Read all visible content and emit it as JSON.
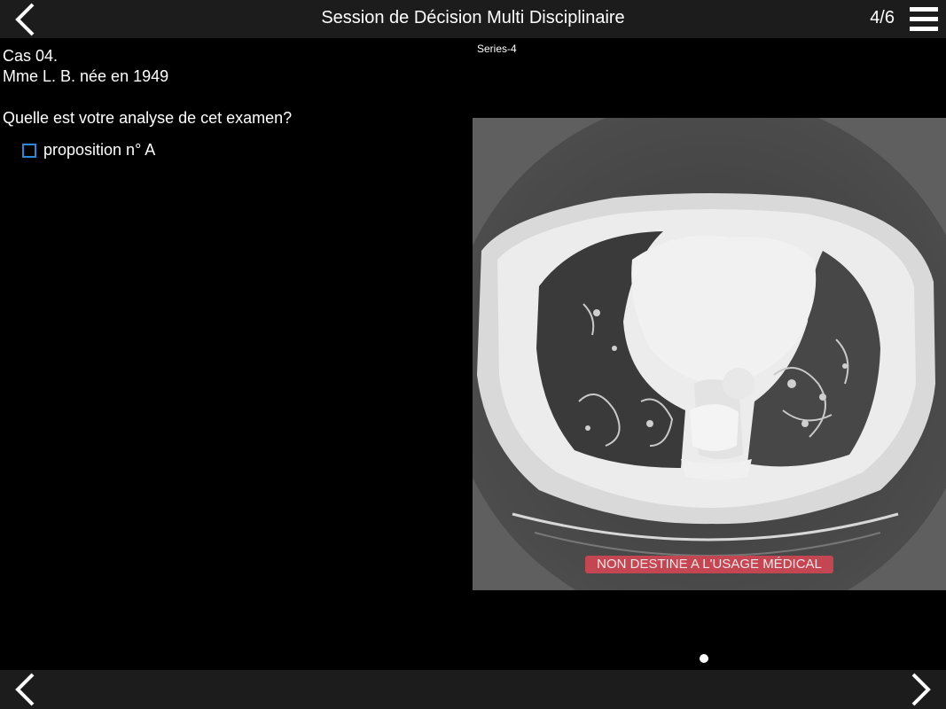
{
  "header": {
    "title": "Session de Décision Multi Disciplinaire",
    "counter": "4/6",
    "back_icon": "chevron-left-icon",
    "menu_icon": "hamburger-menu-icon"
  },
  "case": {
    "number": "Cas 04.",
    "patient": "Mme L. B. née en 1949",
    "question": "Quelle est votre analyse de cet examen?",
    "options": [
      {
        "label": "proposition n° A",
        "checked": false
      }
    ]
  },
  "viewer": {
    "series_label": "Series-4",
    "watermark": "NON DESTINE A L'USAGE MÉDICAL",
    "page_indicator": {
      "current": 1,
      "total": 1
    }
  },
  "footer": {
    "prev_icon": "chevron-left-icon",
    "next_icon": "chevron-right-icon"
  },
  "colors": {
    "bar_background": "#1c1c1c",
    "checkbox_border": "#2f87d6",
    "watermark_background": "#c44652"
  }
}
